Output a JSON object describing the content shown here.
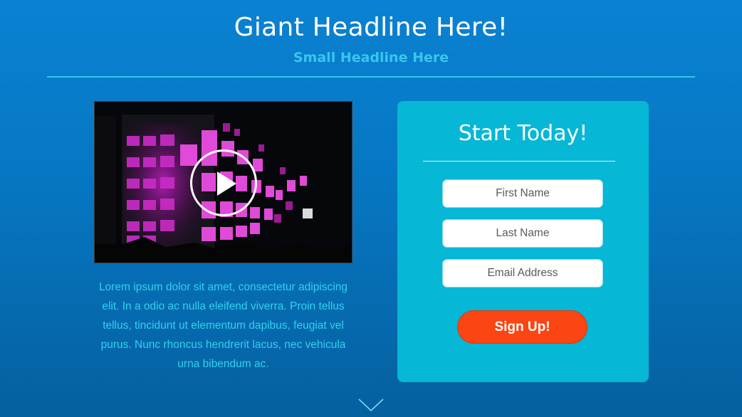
{
  "header": {
    "title": "Giant Headline Here!",
    "subtitle": "Small Headline Here"
  },
  "video": {
    "play_icon": "play-icon"
  },
  "body_text": "Lorem ipsum dolor sit amet, consectetur adipiscing elit. In a odio ac nulla eleifend viverra. Proin tellus tellus, tincidunt ut elementum dapibus, feugiat vel purus. Nunc rhoncus hendrerit lacus, nec vehicula urna bibendum ac.",
  "signup_form": {
    "title": "Start Today!",
    "first_name_placeholder": "First Name",
    "last_name_placeholder": "Last Name",
    "email_placeholder": "Email Address",
    "submit_label": "Sign Up!"
  },
  "scroll_indicator": {
    "icon": "chevron-down-icon"
  },
  "colors": {
    "background": "#0676c2",
    "accent_cyan": "#36c4ea",
    "card": "#06b7d6",
    "button": "#fb4513"
  }
}
